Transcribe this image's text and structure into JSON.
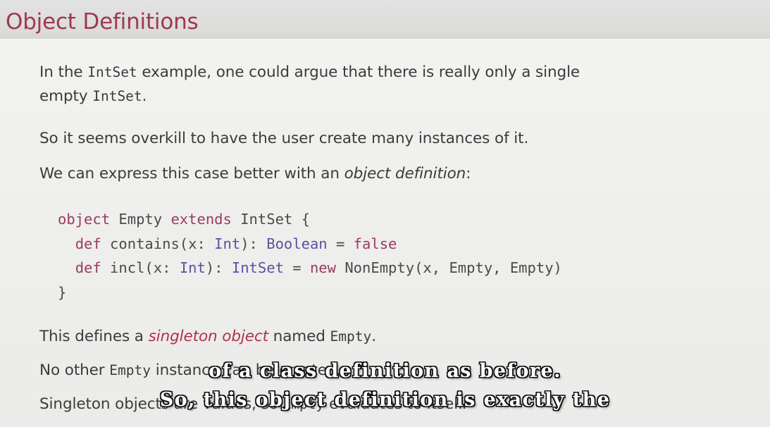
{
  "header": {
    "title": "Object Definitions",
    "title_color": "#a03850",
    "bar_color": "#dcdcda"
  },
  "slide": {
    "background_color": "#f1f1ef",
    "text_color": "#3b3b3b",
    "paragraphs": [
      {
        "id": "p1",
        "runs": [
          {
            "text": "In the ",
            "style": "plain"
          },
          {
            "text": "IntSet",
            "style": "mono"
          },
          {
            "text": " example, one could argue that there is really only a single empty ",
            "style": "plain"
          },
          {
            "text": "IntSet",
            "style": "mono"
          },
          {
            "text": ".",
            "style": "plain"
          }
        ]
      },
      {
        "id": "p2",
        "runs": [
          {
            "text": "So it seems overkill to have the user create many instances of it.",
            "style": "plain"
          }
        ]
      },
      {
        "id": "p3",
        "runs": [
          {
            "text": "We can express this case better with an ",
            "style": "plain"
          },
          {
            "text": "object definition",
            "style": "italic"
          },
          {
            "text": ":",
            "style": "plain"
          }
        ]
      },
      {
        "id": "p4",
        "runs": [
          {
            "text": "This defines a ",
            "style": "plain"
          },
          {
            "text": "singleton object",
            "style": "italic-red"
          },
          {
            "text": " named ",
            "style": "plain"
          },
          {
            "text": "Empty",
            "style": "mono"
          },
          {
            "text": ".",
            "style": "plain"
          }
        ]
      },
      {
        "id": "p5",
        "runs": [
          {
            "text": "No other ",
            "style": "plain"
          },
          {
            "text": "Empty",
            "style": "mono"
          },
          {
            "text": " instance can be created.",
            "style": "plain"
          }
        ]
      },
      {
        "id": "p6",
        "runs": [
          {
            "text": "Singleton objects are values, so ",
            "style": "plain"
          },
          {
            "text": "Empty",
            "style": "mono"
          },
          {
            "text": " evaluates to itself.",
            "style": "plain"
          }
        ]
      }
    ],
    "code_block": {
      "language": "scala",
      "keyword_color": "#9a3b5e",
      "type_color": "#5a52a0",
      "plain_color": "#4a4a4a",
      "lines": [
        [
          {
            "t": "object",
            "c": "kw"
          },
          {
            "t": " Empty ",
            "c": "pln"
          },
          {
            "t": "extends",
            "c": "kw"
          },
          {
            "t": " IntSet {",
            "c": "pln"
          }
        ],
        [
          {
            "t": "  ",
            "c": "pln"
          },
          {
            "t": "def",
            "c": "kw"
          },
          {
            "t": " contains(x: ",
            "c": "pln"
          },
          {
            "t": "Int",
            "c": "typ"
          },
          {
            "t": "): ",
            "c": "pln"
          },
          {
            "t": "Boolean",
            "c": "typ"
          },
          {
            "t": " = ",
            "c": "pln"
          },
          {
            "t": "false",
            "c": "kw"
          }
        ],
        [
          {
            "t": "  ",
            "c": "pln"
          },
          {
            "t": "def",
            "c": "kw"
          },
          {
            "t": " incl(x: ",
            "c": "pln"
          },
          {
            "t": "Int",
            "c": "typ"
          },
          {
            "t": "): ",
            "c": "pln"
          },
          {
            "t": "IntSet",
            "c": "typ"
          },
          {
            "t": " = ",
            "c": "pln"
          },
          {
            "t": "new",
            "c": "kw"
          },
          {
            "t": " NonEmpty(x, Empty, Empty)",
            "c": "pln"
          }
        ],
        [
          {
            "t": "}",
            "c": "pln"
          }
        ]
      ]
    }
  },
  "subtitles": {
    "lines": [
      "of a class definition as before.",
      "So, this object definition is exactly the"
    ],
    "text_color": "#ffffff",
    "outline_color": "#111111"
  }
}
